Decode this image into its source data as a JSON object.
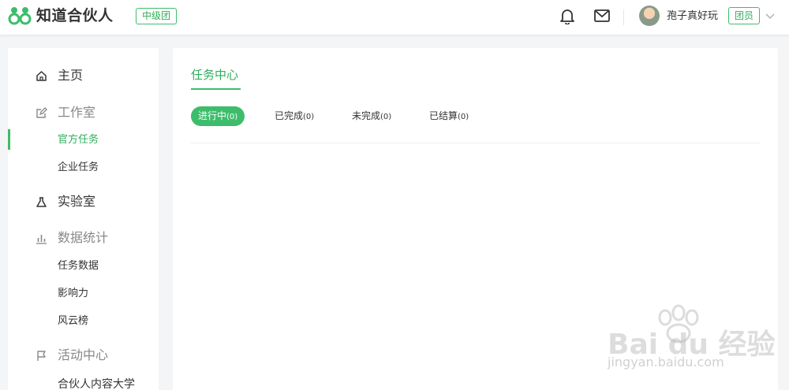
{
  "header": {
    "brand": "知道合伙人",
    "level_badge": "中级团",
    "username": "孢子真好玩",
    "role_badge": "团员"
  },
  "sidebar": {
    "home": "主页",
    "studio": "工作室",
    "official_tasks": "官方任务",
    "enterprise_tasks": "企业任务",
    "lab": "实验室",
    "stats": "数据统计",
    "task_data": "任务数据",
    "influence": "影响力",
    "ranking": "风云榜",
    "activity": "活动中心",
    "university": "合伙人内容大学"
  },
  "main": {
    "title": "任务中心",
    "tabs": [
      {
        "label": "进行中",
        "count": "(0)"
      },
      {
        "label": "已完成",
        "count": "(0)"
      },
      {
        "label": "未完成",
        "count": "(0)"
      },
      {
        "label": "已结算",
        "count": "(0)"
      }
    ]
  },
  "watermark": {
    "brand": "Bai du 经验",
    "url": "jingyan.baidu.com"
  },
  "colors": {
    "accent": "#3dbd6b"
  }
}
